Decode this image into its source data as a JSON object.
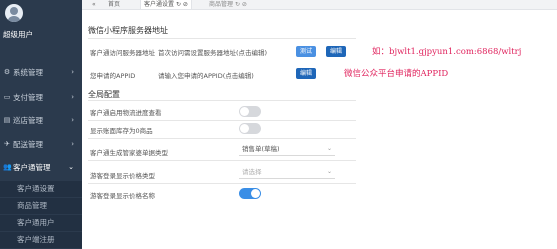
{
  "sidebar": {
    "username": "超级用户",
    "menu": [
      {
        "icon": "⚙",
        "label": "系统管理",
        "arrow": "›"
      },
      {
        "icon": "▭",
        "label": "支付管理",
        "arrow": "›"
      },
      {
        "icon": "▤",
        "label": "巡店管理",
        "arrow": "›"
      },
      {
        "icon": "✈",
        "label": "配送管理",
        "arrow": "›"
      },
      {
        "icon": "👥",
        "label": "客户通管理",
        "arrow": "⌄"
      }
    ],
    "submenu": [
      "客户通设置",
      "商品管理",
      "客户通用户",
      "客户端注册"
    ]
  },
  "tabbar": {
    "nav_back": "«",
    "home": "首页",
    "tabs": [
      {
        "label": "客户通设置",
        "refresh": "↻",
        "close": "⊘"
      },
      {
        "label": "商品管理",
        "refresh": "↻",
        "close": "⊘"
      }
    ]
  },
  "main": {
    "mp_title": "微信小程序服务器地址",
    "mp_row": {
      "label": "客户通访问服务器地址",
      "value": "首次访问需设置服务器地址(点击编辑)",
      "test_button": "测试",
      "edit_button": "编辑",
      "note": "如：bjwlt1.gjpyun1.com:6868/wltrj"
    },
    "appid_row": {
      "label": "您申请的APPID",
      "value": "请输入您申请的APPID(点击编辑)",
      "edit_button": "编辑",
      "note": "微信公众平台申请的APPID"
    },
    "global_title": "全局配置",
    "settings": [
      {
        "label": "客户通启用物流进度查看",
        "type": "toggle",
        "on": false
      },
      {
        "label": "显示账面库存为0商品",
        "type": "toggle",
        "on": false
      },
      {
        "label": "客户通生成管家婆单据类型",
        "type": "select",
        "value": "销售单(草稿)",
        "placeholder": ""
      },
      {
        "label": "游客登录显示价格类型",
        "type": "select",
        "value": "",
        "placeholder": "请选择"
      },
      {
        "label": "游客登录显示价格名称",
        "type": "toggle",
        "on": true
      }
    ]
  }
}
